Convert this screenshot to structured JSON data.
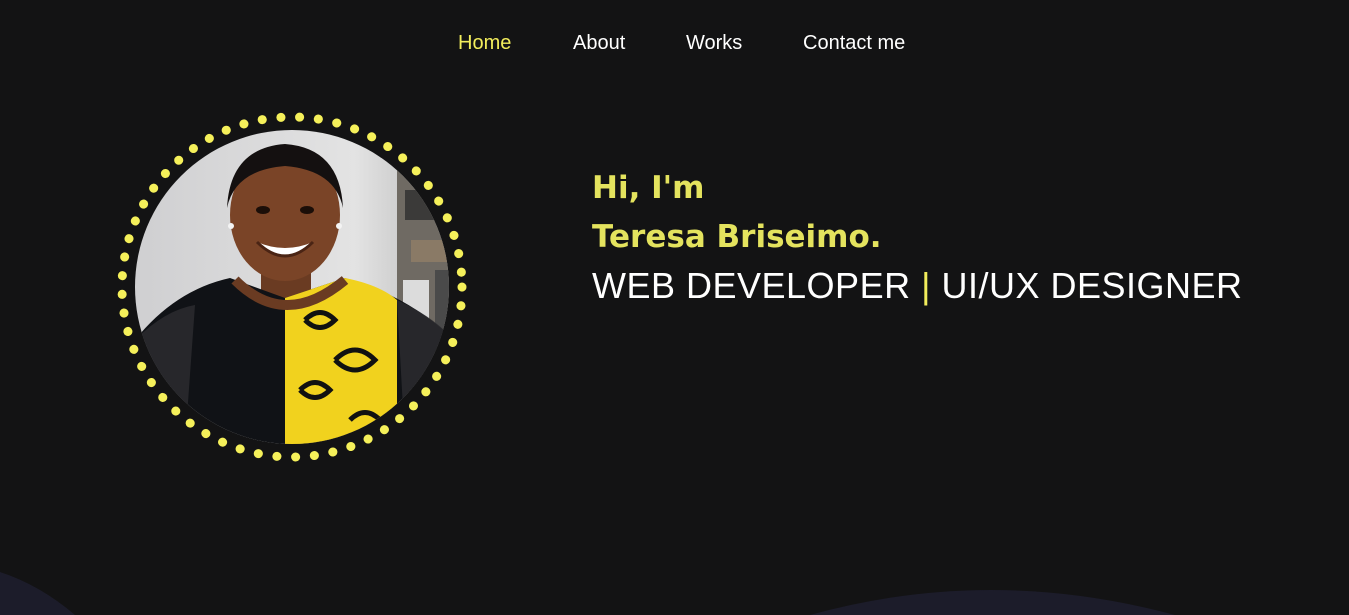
{
  "nav": {
    "items": [
      {
        "label": "Home",
        "active": true
      },
      {
        "label": "About",
        "active": false
      },
      {
        "label": "Works",
        "active": false
      },
      {
        "label": "Contact me",
        "active": false
      }
    ]
  },
  "hero": {
    "greeting": "Hi, I'm",
    "name": "Teresa Briseimo.",
    "role_1": "WEB DEVELOPER",
    "separator": "|",
    "role_2": "UI/UX DESIGNER"
  },
  "colors": {
    "background": "#131314",
    "accent": "#e4e35e",
    "text": "#ffffff",
    "wave": "#1c1c2a"
  }
}
